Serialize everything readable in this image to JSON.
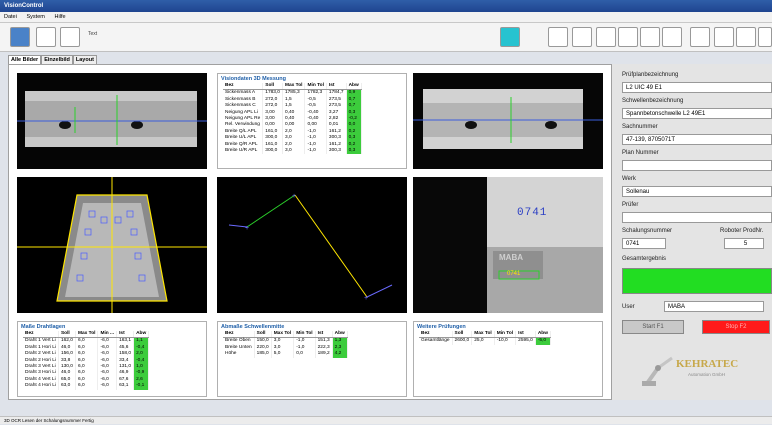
{
  "app": {
    "title": "VisionControl"
  },
  "menu": [
    "Datei",
    "System",
    "Hilfe"
  ],
  "toolbar": {
    "text_label": "Text"
  },
  "tabs": [
    "Alle Bilder",
    "Einzelbild",
    "Layout"
  ],
  "measure3d": {
    "title": "Visiondaten 3D Messung",
    "headers": [
      "Bez",
      "Soll",
      "Max Tol",
      "Min Tol",
      "Ist",
      "Abw"
    ],
    "rows": [
      [
        "Sickenmass A",
        "1783,0",
        "1785,3",
        "1782,3",
        "1784,7",
        "0,9"
      ],
      [
        "Sickenmass B",
        "272,0",
        "1,5",
        "-0,5",
        "273,5",
        "0,7"
      ],
      [
        "Sickenmass C",
        "272,0",
        "1,5",
        "-0,5",
        "273,5",
        "0,7"
      ],
      [
        "Neigung APL Li",
        "3,00",
        "0,40",
        "-0,40",
        "3,27",
        "0,3"
      ],
      [
        "Neigung APL Re",
        "3,00",
        "0,40",
        "-0,40",
        "2,82",
        "-0,2"
      ],
      [
        "Rel. Verwindung",
        "0,00",
        "0,00",
        "0,00",
        "0,01",
        "0,0"
      ],
      [
        "Breite Q/L APL",
        "161,0",
        "2,0",
        "-1,0",
        "161,2",
        "0,2"
      ],
      [
        "Breite U/L APL",
        "300,0",
        "3,0",
        "-1,0",
        "300,3",
        "0,3"
      ],
      [
        "Breite Q/R APL",
        "161,0",
        "2,0",
        "-1,0",
        "161,2",
        "0,2"
      ],
      [
        "Breite U/R APL",
        "300,0",
        "3,0",
        "-1,0",
        "300,3",
        "0,3"
      ]
    ]
  },
  "wires": {
    "title": "Maße Drahtlagen",
    "headers": [
      "Bez",
      "Soll",
      "Max Tol",
      "Min ...",
      "Ist",
      "Abw"
    ],
    "rows": [
      [
        "Draht 1 Vert Li",
        "162,0",
        "6,0",
        "-6,0",
        "163,1",
        "1,1"
      ],
      [
        "Draht 1 Hori Li",
        "46,0",
        "6,0",
        "-6,0",
        "45,6",
        "-0,4"
      ],
      [
        "Draht 2 Vert Li",
        "156,0",
        "6,0",
        "-6,0",
        "158,0",
        "2,0"
      ],
      [
        "Draht 2 Hori Li",
        "33,8",
        "6,0",
        "-6,0",
        "33,4",
        "-0,4"
      ],
      [
        "Draht 3 Vert Li",
        "130,0",
        "6,0",
        "-6,0",
        "131,0",
        "1,0"
      ],
      [
        "Draht 3 Hori Li",
        "46,0",
        "6,0",
        "-6,0",
        "46,9",
        "-0,9"
      ],
      [
        "Draht 4 Vert Li",
        "65,0",
        "6,0",
        "-6,0",
        "67,6",
        "2,6"
      ],
      [
        "Draht 4 Hori Li",
        "63,0",
        "6,0",
        "-6,0",
        "63,1",
        "-0,1"
      ]
    ]
  },
  "sleeper": {
    "title": "Abmaße Schwellenmitte",
    "headers": [
      "Bez",
      "Soll",
      "Max Tol",
      "Min Tol",
      "Ist",
      "Abw"
    ],
    "rows": [
      [
        "Breite Oben",
        "150,0",
        "3,0",
        "-1,0",
        "151,3",
        "1,3"
      ],
      [
        "Breite Unten",
        "220,0",
        "3,0",
        "-1,0",
        "222,3",
        "2,3"
      ],
      [
        "Höhe",
        "185,0",
        "5,0",
        "0,0",
        "189,2",
        "4,2"
      ]
    ]
  },
  "further": {
    "title": "Weitere Prüfungen",
    "headers": [
      "Bez",
      "Soll",
      "Max Tol",
      "Min Tol",
      "Ist",
      "Abw"
    ],
    "rows": [
      [
        "Gesamtlänge",
        "2600,0",
        "25,0",
        "-10,0",
        "2595,0",
        "-5,0"
      ]
    ]
  },
  "ocr": {
    "number": "0741",
    "plate": "MABA",
    "plate_num": "0741"
  },
  "right": {
    "plan_label": "Prüfplanbezeichnung",
    "plan_value": "L2 UIC 49 E1",
    "sleeper_label": "Schwellenbezeichnung",
    "sleeper_value": "Spannbetonschwelle L2 49E1",
    "part_label": "Sachnummer",
    "part_value": "47-139, 8705071T",
    "plannr_label": "Plan Nummer",
    "plannr_value": "",
    "plant_label": "Werk",
    "plant_value": "Sollenau",
    "tester_label": "Prüfer",
    "tester_value": "",
    "mold_label": "Schalungsnummer",
    "mold_value": "0741",
    "robot_label": "Roboter ProdNr.",
    "robot_value": "5",
    "result_label": "Gesamtergebnis",
    "result_color": "#22dd22",
    "user_label": "User",
    "user_value": "MABA",
    "start_label": "Start  F1",
    "stop_label": "Stop  F2",
    "logo_text": "KEHRATEC",
    "logo_sub": "Automation GmbH"
  },
  "status": "3D OCR Lesen der Schalungsnummer Fertig"
}
